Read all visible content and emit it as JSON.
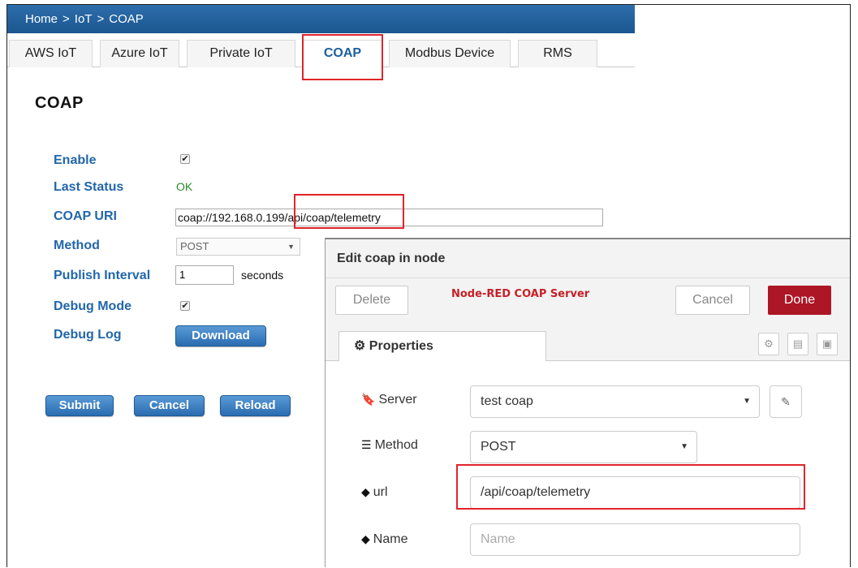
{
  "breadcrumb": [
    "Home",
    "IoT",
    "COAP"
  ],
  "breadcrumb_sep": ">",
  "tabs": [
    "AWS IoT",
    "Azure IoT",
    "Private IoT",
    "COAP",
    "Modbus Device",
    "RMS"
  ],
  "active_tab": "COAP",
  "page_title": "COAP",
  "form": {
    "enable_label": "Enable",
    "enable_checked": true,
    "last_status_label": "Last Status",
    "last_status_value": "OK",
    "uri_label": "COAP URI",
    "uri_value": "coap://192.168.0.199/api/coap/telemetry",
    "method_label": "Method",
    "method_value": "POST",
    "interval_label": "Publish Interval",
    "interval_value": "1",
    "interval_unit": "seconds",
    "debug_mode_label": "Debug Mode",
    "debug_mode_checked": true,
    "debug_log_label": "Debug Log",
    "download_label": "Download"
  },
  "buttons": {
    "submit": "Submit",
    "cancel": "Cancel",
    "reload": "Reload"
  },
  "nodered": {
    "title": "Edit coap in node",
    "delete": "Delete",
    "server_name": "Node-RED COAP Server",
    "cancel": "Cancel",
    "done": "Done",
    "properties_tab": "Properties",
    "server_label": "Server",
    "server_value": "test coap",
    "method_label": "Method",
    "method_value": "POST",
    "url_label": "url",
    "url_value": "/api/coap/telemetry",
    "name_label": "Name",
    "name_placeholder": "Name"
  },
  "colors": {
    "accent_red": "#e0242b",
    "done_red": "#ad1625",
    "header_blue": "#1b5690",
    "label_blue": "#2266aa"
  },
  "icons": [
    "gear-icon",
    "bookmark-icon",
    "list-icon",
    "tag-icon",
    "pencil-icon",
    "document-icon",
    "frame-icon",
    "checkbox-icon"
  ]
}
